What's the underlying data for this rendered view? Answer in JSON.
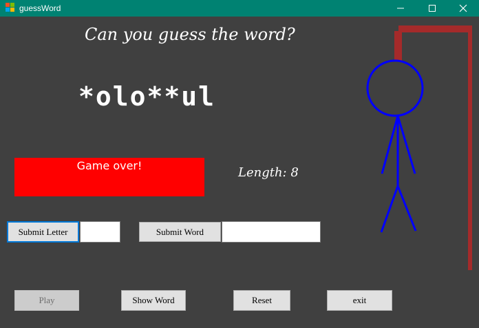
{
  "window": {
    "title": "guessWord",
    "controls": {
      "minimize": "minimize-icon",
      "maximize": "maximize-icon",
      "close": "close-icon"
    }
  },
  "game": {
    "heading": "Can you guess the word?",
    "masked_word": "*olo**ul",
    "status_message": "Game over!",
    "length_label": "Length: 8"
  },
  "controls": {
    "submit_letter_label": "Submit Letter",
    "letter_input_value": "",
    "submit_word_label": "Submit Word",
    "word_input_value": "",
    "play_label": "Play",
    "show_word_label": "Show Word",
    "reset_label": "Reset",
    "exit_label": "exit"
  },
  "colors": {
    "background": "#404040",
    "titlebar": "#008272",
    "status_background": "#ff0000",
    "gallows": "#a52a2a",
    "figure": "#0000ff"
  }
}
